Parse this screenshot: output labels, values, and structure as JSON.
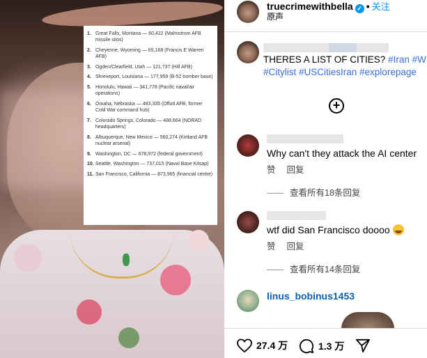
{
  "post": {
    "username": "truecrimewithbella",
    "follow_label": "关注",
    "audio_label": "原声",
    "caption_line1": "THERES A LIST OF CITIES? ",
    "caption_tags_line1": "#Iran #W",
    "caption_tags_line2": "#Citylist #USCitiesIran #explorepage"
  },
  "overlay_list": [
    {
      "num": "1.",
      "text": "Great Falls, Montana — 60,422 (Malmstrom AFB missile silos)"
    },
    {
      "num": "2.",
      "text": "Cheyenne, Wyoming — 65,168 (Francis E Warren AFB)"
    },
    {
      "num": "3.",
      "text": "Ogden/Clearfield, Utah — 121,737 (Hill AFB)"
    },
    {
      "num": "4.",
      "text": "Shreveport, Louisiana — 177,959 (B-52 bomber base)"
    },
    {
      "num": "5.",
      "text": "Honolulu, Hawaii — 341,778 (Pacific naval/air operations)"
    },
    {
      "num": "6.",
      "text": "Omaha, Nebraska — 483,335 (Offutt AFB, former Cold War command hub)"
    },
    {
      "num": "7.",
      "text": "Colorado Springs, Colorado — 488,664 (NORAD headquarters)"
    },
    {
      "num": "8.",
      "text": "Albuquerque, New Mexico — 560,274 (Kirtland AFB nuclear arsenal)"
    },
    {
      "num": "9.",
      "text": "Washington, DC — 678,972 (federal government)"
    },
    {
      "num": "10.",
      "text": "Seattle, Washington — 737,015 (Naval Base Kitsap)"
    },
    {
      "num": "11.",
      "text": "San Francisco, California — 873,965 (financial centre)"
    }
  ],
  "comments": [
    {
      "text": "Why can't they attack the AI center",
      "like": "赞",
      "reply": "回复",
      "view_replies": "查看所有18条回复"
    },
    {
      "text": "wtf did San Francisco doooo",
      "like": "赞",
      "reply": "回复",
      "view_replies": "查看所有14条回复"
    }
  ],
  "third_comment_user": "linus_bobinus1453",
  "actions": {
    "likes": "27.4 万",
    "comments": "1.3 万"
  },
  "icons": {
    "verified": "verified-badge-icon",
    "add": "add-circle-icon",
    "heart": "heart-icon",
    "comment": "comment-bubble-icon",
    "share": "paper-plane-icon",
    "emoji": "crying-laughing-emoji-icon"
  },
  "colors": {
    "accent": "#0095f6",
    "hashtag": "#3a6fd8",
    "linus_name": "#0a5fa8"
  }
}
